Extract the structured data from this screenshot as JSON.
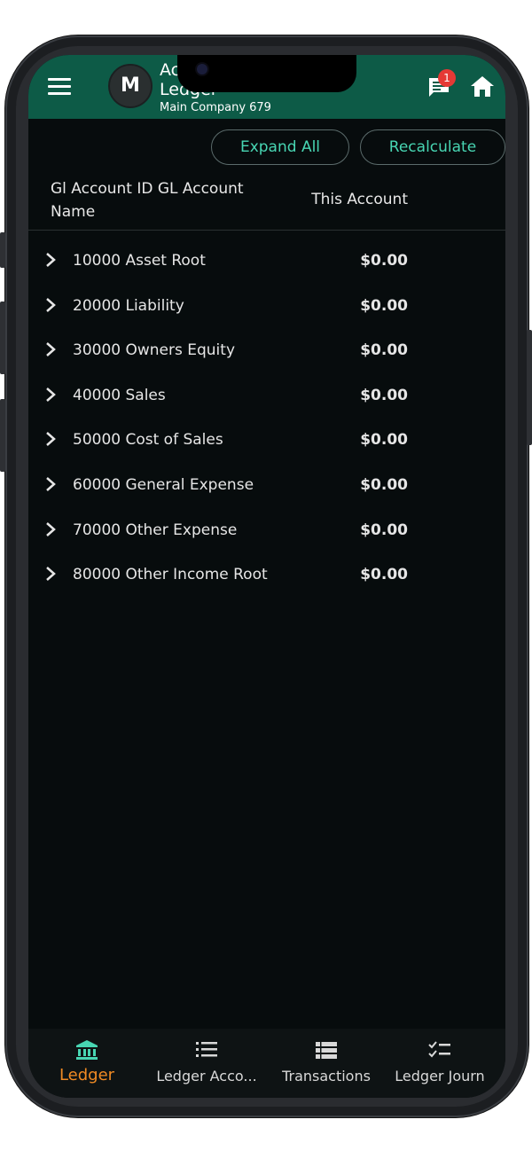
{
  "header": {
    "title": "Account Ledger",
    "subtitle": "Main Company 679",
    "avatar_letter": "M",
    "notification_count": "1"
  },
  "actions": {
    "expand_label": "Expand All",
    "recalculate_label": "Recalculate"
  },
  "table": {
    "col_name": "Gl Account ID GL Account Name",
    "col_amount": "This Account",
    "rows": [
      {
        "name": "10000 Asset Root",
        "amount": "$0.00"
      },
      {
        "name": "20000 Liability",
        "amount": "$0.00"
      },
      {
        "name": "30000 Owners Equity",
        "amount": "$0.00"
      },
      {
        "name": "40000 Sales",
        "amount": "$0.00"
      },
      {
        "name": "50000 Cost of Sales",
        "amount": "$0.00"
      },
      {
        "name": "60000 General Expense",
        "amount": "$0.00"
      },
      {
        "name": "70000 Other Expense",
        "amount": "$0.00"
      },
      {
        "name": "80000 Other Income Root",
        "amount": "$0.00"
      }
    ]
  },
  "nav": {
    "items": [
      {
        "label": "Ledger",
        "icon": "bank-icon",
        "active": true
      },
      {
        "label": "Ledger Acco...",
        "icon": "list-icon",
        "active": false
      },
      {
        "label": "Transactions",
        "icon": "table-list-icon",
        "active": false
      },
      {
        "label": "Ledger Journ",
        "icon": "checklist-icon",
        "active": false
      }
    ]
  },
  "colors": {
    "header_bg": "#0d5b47",
    "accent": "#48d6b3",
    "active_nav": "#f08a24",
    "badge": "#e53935",
    "background": "#070c0d"
  }
}
